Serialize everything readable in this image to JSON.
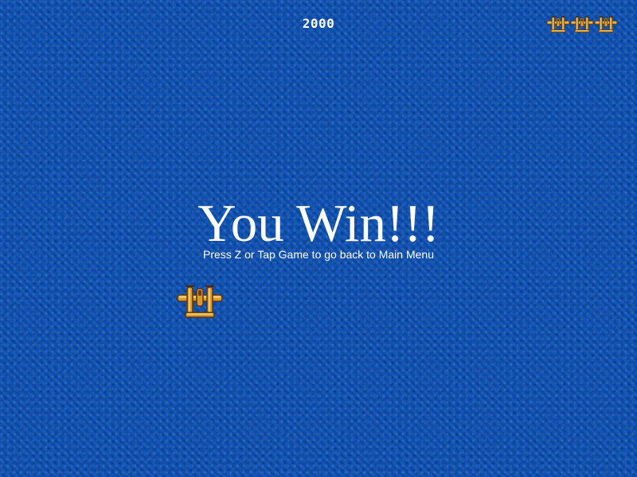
{
  "hud": {
    "score": "2000",
    "lives_remaining": 3,
    "life_icon": "p38-plane-icon"
  },
  "message": {
    "title": "You Win!!!",
    "instruction": "Press Z or Tap Game to go back to Main Menu"
  },
  "player": {
    "icon": "p38-plane-icon"
  },
  "colors": {
    "ocean": "#0b4fb3",
    "text": "#ffffff",
    "plane_body": "#d89a2e",
    "plane_outline": "#5a3510"
  }
}
